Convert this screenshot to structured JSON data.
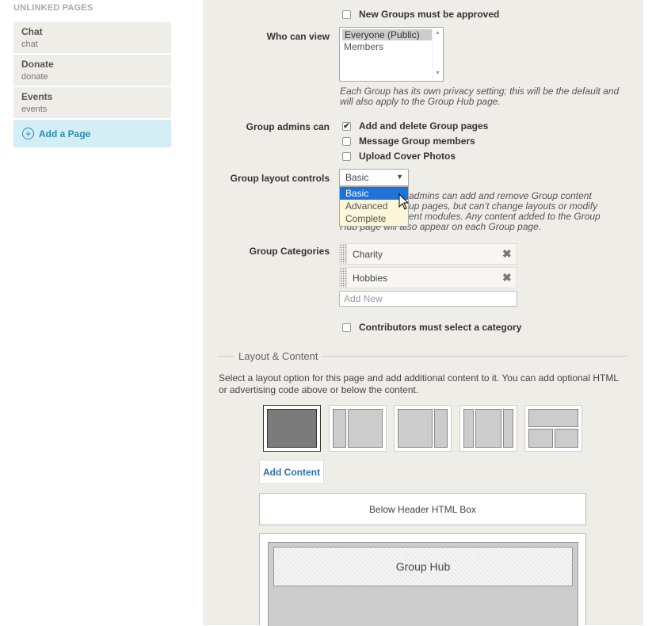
{
  "sidebar": {
    "title": "UNLINKED PAGES",
    "pages": [
      {
        "name": "Chat",
        "slug": "chat"
      },
      {
        "name": "Donate",
        "slug": "donate"
      },
      {
        "name": "Events",
        "slug": "events"
      }
    ],
    "add_page_label": "Add a Page"
  },
  "settings": {
    "new_groups_approved_label": "New Groups must be approved",
    "who_can_view": {
      "label": "Who can view",
      "options": [
        "Everyone (Public)",
        "Members"
      ],
      "selected": "Everyone (Public)",
      "help": "Each Group has its own privacy setting; this will be the default and will also apply to the Group Hub page."
    },
    "group_admins": {
      "label": "Group admins can",
      "options": [
        {
          "label": "Add and delete Group pages",
          "checked": true
        },
        {
          "label": "Message Group members",
          "checked": false
        },
        {
          "label": "Upload Cover Photos",
          "checked": false
        }
      ]
    },
    "layout_controls": {
      "label": "Group layout controls",
      "value": "Basic",
      "options": [
        "Basic",
        "Advanced",
        "Complete"
      ],
      "help_lines": [
        "admins can add and remove Group content",
        "up pages, but can’t change layouts or modify",
        "ent modules. Any content added to the Group",
        "Hub page will also appear on each Group page."
      ]
    },
    "categories": {
      "label": "Group Categories",
      "items": [
        "Charity",
        "Hobbies"
      ],
      "add_placeholder": "Add New",
      "must_select_label": "Contributors must select a category"
    }
  },
  "layout_section": {
    "title": "Layout & Content",
    "description": "Select a layout option for this page and add additional content to it. You can add optional HTML or advertising code above or below the content.",
    "add_content_label": "Add Content",
    "below_header_label": "Below Header HTML Box",
    "group_hub_label": "Group Hub"
  },
  "colors": {
    "panel_bg": "#eeede8",
    "accent": "#2a8ab3",
    "dropdown_highlight": "#1e73d8"
  }
}
